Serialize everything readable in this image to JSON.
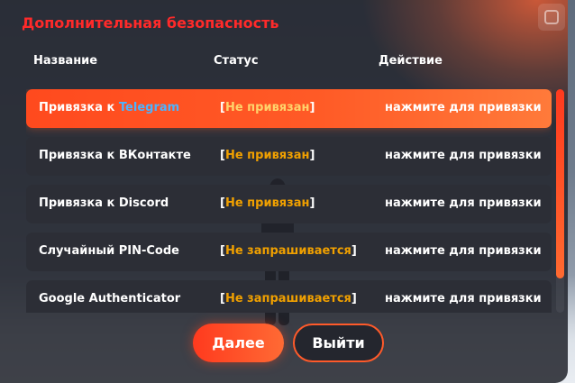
{
  "window": {
    "title": "Дополнительная безопасность"
  },
  "columns": {
    "name": "Название",
    "status": "Статус",
    "action": "Действие"
  },
  "rows": [
    {
      "name_prefix": "Привязка к ",
      "name_highlight": "Telegram",
      "status_open": "[",
      "status_value": "Не привязан",
      "status_close": "]",
      "action": "нажмите для привязки",
      "selected": true
    },
    {
      "name_prefix": "Привязка к ВКонтакте",
      "name_highlight": "",
      "status_open": "[",
      "status_value": "Не привязан",
      "status_close": "]",
      "action": "нажмите для привязки",
      "selected": false
    },
    {
      "name_prefix": "Привязка к Discord",
      "name_highlight": "",
      "status_open": "[",
      "status_value": "Не привязан",
      "status_close": "]",
      "action": "нажмите для привязки",
      "selected": false
    },
    {
      "name_prefix": "Случайный PIN-Code",
      "name_highlight": "",
      "status_open": "[",
      "status_value": "Не запрашивается",
      "status_close": "]",
      "action": "нажмите для привязки",
      "selected": false
    },
    {
      "name_prefix": "Google Authenticator",
      "name_highlight": "",
      "status_open": "[",
      "status_value": "Не запрашивается",
      "status_close": "]",
      "action": "нажмите для привязки",
      "selected": false
    }
  ],
  "buttons": {
    "next": "Далее",
    "exit": "Выйти"
  },
  "colors": {
    "accent": "#ff4a1e",
    "title": "#ff2a2a",
    "status": "#f0a000",
    "telegram": "#4db3ff",
    "row_bg": "#2c2e36"
  },
  "icons": {
    "corner": "logo-icon"
  }
}
